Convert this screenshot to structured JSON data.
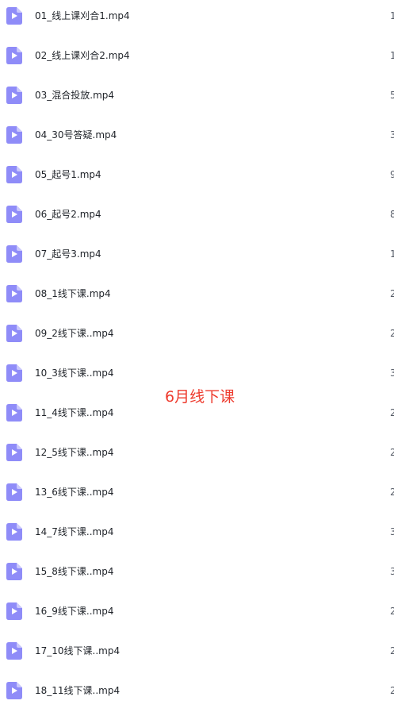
{
  "folder_label": "6月线下课",
  "files": [
    {
      "name": "01_线上课刈合1.mp4",
      "meta": "1"
    },
    {
      "name": "02_线上课刈合2.mp4",
      "meta": "1"
    },
    {
      "name": "03_混合投放.mp4",
      "meta": "5"
    },
    {
      "name": "04_30号答疑.mp4",
      "meta": "3"
    },
    {
      "name": "05_起号1.mp4",
      "meta": "9"
    },
    {
      "name": "06_起号2.mp4",
      "meta": "8"
    },
    {
      "name": "07_起号3.mp4",
      "meta": "1"
    },
    {
      "name": "08_1线下课.mp4",
      "meta": "2"
    },
    {
      "name": "09_2线下课..mp4",
      "meta": "2"
    },
    {
      "name": "10_3线下课..mp4",
      "meta": "3"
    },
    {
      "name": "11_4线下课..mp4",
      "meta": "2"
    },
    {
      "name": "12_5线下课..mp4",
      "meta": "2"
    },
    {
      "name": "13_6线下课..mp4",
      "meta": "2"
    },
    {
      "name": "14_7线下课..mp4",
      "meta": "3"
    },
    {
      "name": "15_8线下课..mp4",
      "meta": "3"
    },
    {
      "name": "16_9线下课..mp4",
      "meta": "2"
    },
    {
      "name": "17_10线下课..mp4",
      "meta": "2"
    },
    {
      "name": "18_11线下课..mp4",
      "meta": "2"
    }
  ],
  "icon": "video-file-icon",
  "colors": {
    "icon": "#8f8cf8",
    "accent_text": "#ee3b2e"
  }
}
